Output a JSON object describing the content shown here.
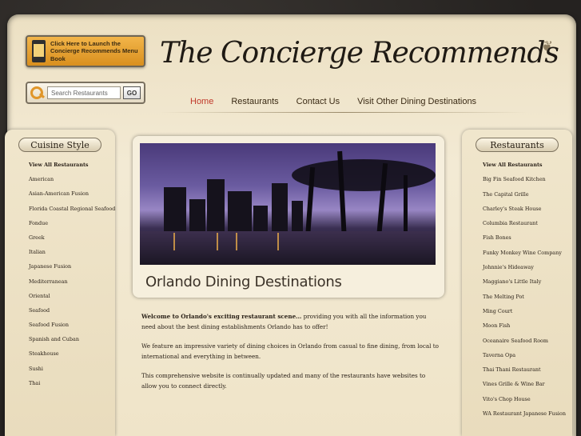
{
  "site": {
    "title": "The Concierge Recommends",
    "menu_book_label": "Click Here to Launch the Concierge Recommends Menu Book"
  },
  "search": {
    "placeholder": "Search Restaurants",
    "value": "",
    "go_label": "GO"
  },
  "nav": [
    {
      "label": "Home",
      "active": true
    },
    {
      "label": "Restaurants",
      "active": false
    },
    {
      "label": "Contact Us",
      "active": false
    },
    {
      "label": "Visit Other Dining Destinations",
      "active": false
    }
  ],
  "left_sidebar": {
    "title": "Cuisine Style",
    "items": [
      "View All Restaurants",
      "American",
      "Asian-American Fusion",
      "Florida Coastal Regional Seafood",
      "Fondue",
      "Greek",
      "Italian",
      "Japanese Fusion",
      "Mediterranean",
      "Oriental",
      "Seafood",
      "Seafood Fusion",
      "Spanish and Cuban",
      "Steakhouse",
      "Sushi",
      "Thai"
    ]
  },
  "right_sidebar": {
    "title": "Restaurants",
    "items": [
      "View All Restaurants",
      "Big Fin Seafood Kitchen",
      "The Capital Grille",
      "Charley's Steak House",
      "Columbia Restaurant",
      "Fish Bones",
      "Funky Monkey Wine Company",
      "Johnnie's Hideaway",
      "Maggiano's Little Italy",
      "The Melting Pot",
      "Ming Court",
      "Moon Fish",
      "Oceanaire Seafood Room",
      "Taverna Opa",
      "Thai Thani Restaurant",
      "Vines Grille & Wine Bar",
      "Vito's Chop House",
      "WA Restaurant Japanese Fusion"
    ]
  },
  "hero": {
    "caption": "Orlando Dining Destinations"
  },
  "intro": {
    "lead": "Welcome to Orlando's exciting restaurant scene…",
    "p1_rest": " providing you with all the information you need about the best dining establishments Orlando has to offer!",
    "p2": "We feature an impressive variety of dining choices in Orlando from casual to fine dining, from local to international and everything in between.",
    "p3": "This comprehensive website is continually updated and many of the restaurants have websites to allow you to connect directly."
  },
  "colors": {
    "accent_orange": "#e0962a",
    "active_nav": "#c0392b",
    "parchment": "#efe4c8"
  }
}
